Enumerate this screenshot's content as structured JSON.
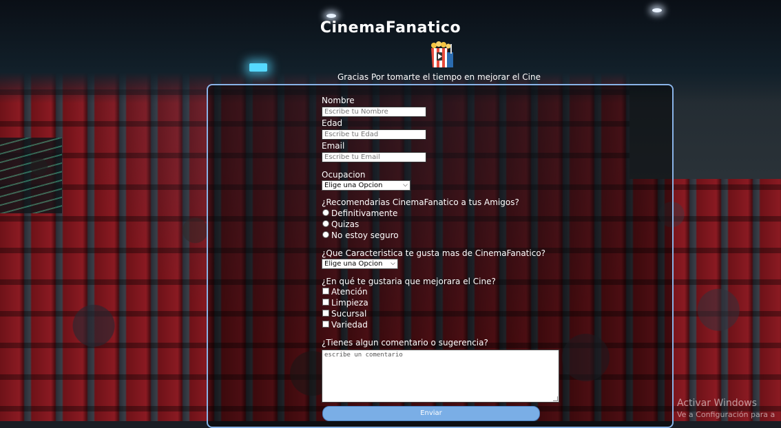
{
  "header": {
    "brand": "CinemaFanatico",
    "subtitle": "Gracias Por tomarte el tiempo en mejorar el Cine"
  },
  "form": {
    "name": {
      "label": "Nombre",
      "placeholder": "Escribe tu Nombre"
    },
    "age": {
      "label": "Edad",
      "placeholder": "Escribe tu Edad"
    },
    "email": {
      "label": "Email",
      "placeholder": "Escribe tu Email"
    },
    "occupation": {
      "label": "Ocupacion",
      "selected": "Elige una Opcion"
    },
    "recommend": {
      "question": "¿Recomendarias CinemaFanatico a tus Amigos?",
      "options": [
        "Definitivamente",
        "Quizas",
        "No estoy seguro"
      ]
    },
    "feature": {
      "question": "¿Que Caracteristica te gusta mas de CinemaFanatico?",
      "selected": "Elige una Opcion"
    },
    "improve": {
      "question": "¿En qué te gustaria que mejorara el Cine?",
      "options": [
        "Atención",
        "Limpieza",
        "Sucursal",
        "Variedad"
      ]
    },
    "comment": {
      "question": "¿Tienes algun comentario o sugerencia?",
      "placeholder": "escribe un comentario"
    },
    "submit_label": "Enviar"
  },
  "watermark": {
    "line1": "Activar Windows",
    "line2": "Ve a Configuración para a"
  }
}
